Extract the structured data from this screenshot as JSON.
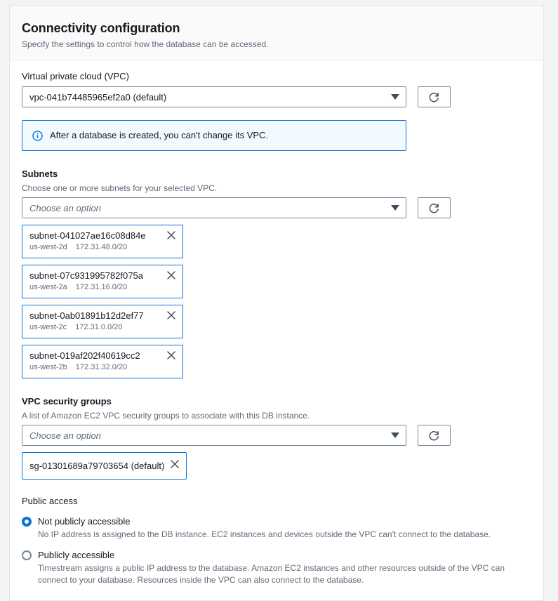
{
  "header": {
    "title": "Connectivity configuration",
    "subtitle": "Specify the settings to control how the database can be accessed."
  },
  "vpc": {
    "label": "Virtual private cloud (VPC)",
    "selected": "vpc-041b74485965ef2a0 (default)",
    "refresh_icon": "refresh-icon",
    "caret_icon": "chevron-down-icon",
    "alert": {
      "icon": "info-icon",
      "text": "After a database is created, you can't change its VPC."
    }
  },
  "subnets": {
    "label": "Subnets",
    "description": "Choose one or more subnets for your selected VPC.",
    "placeholder": "Choose an option",
    "refresh_icon": "refresh-icon",
    "tokens": [
      {
        "id": "subnet-041027ae16c08d84e",
        "az": "us-west-2d",
        "cidr": "172.31.48.0/20"
      },
      {
        "id": "subnet-07c931995782f075a",
        "az": "us-west-2a",
        "cidr": "172.31.16.0/20"
      },
      {
        "id": "subnet-0ab01891b12d2ef77",
        "az": "us-west-2c",
        "cidr": "172.31.0.0/20"
      },
      {
        "id": "subnet-019af202f40619cc2",
        "az": "us-west-2b",
        "cidr": "172.31.32.0/20"
      }
    ]
  },
  "security_groups": {
    "label": "VPC security groups",
    "description": "A list of Amazon EC2 VPC security groups to associate with this DB instance.",
    "placeholder": "Choose an option",
    "refresh_icon": "refresh-icon",
    "tokens": [
      {
        "id": "sg-01301689a79703654 (default)"
      }
    ]
  },
  "public_access": {
    "label": "Public access",
    "options": [
      {
        "label": "Not publicly accessible",
        "description": "No IP address is assigned to the DB instance. EC2 instances and devices outside the VPC can't connect to the database.",
        "selected": true
      },
      {
        "label": "Publicly accessible",
        "description": "Timestream assigns a public IP address to the database. Amazon EC2 instances and other resources outside of the VPC can connect to your database. Resources inside the VPC can also connect to the database.",
        "selected": false
      }
    ]
  },
  "colors": {
    "accent": "#0972d3",
    "border": "#7d8998",
    "text": "#16191f",
    "muted": "#5f6b7a",
    "alert_bg": "#f1faff",
    "header_bg": "#fafafa"
  }
}
